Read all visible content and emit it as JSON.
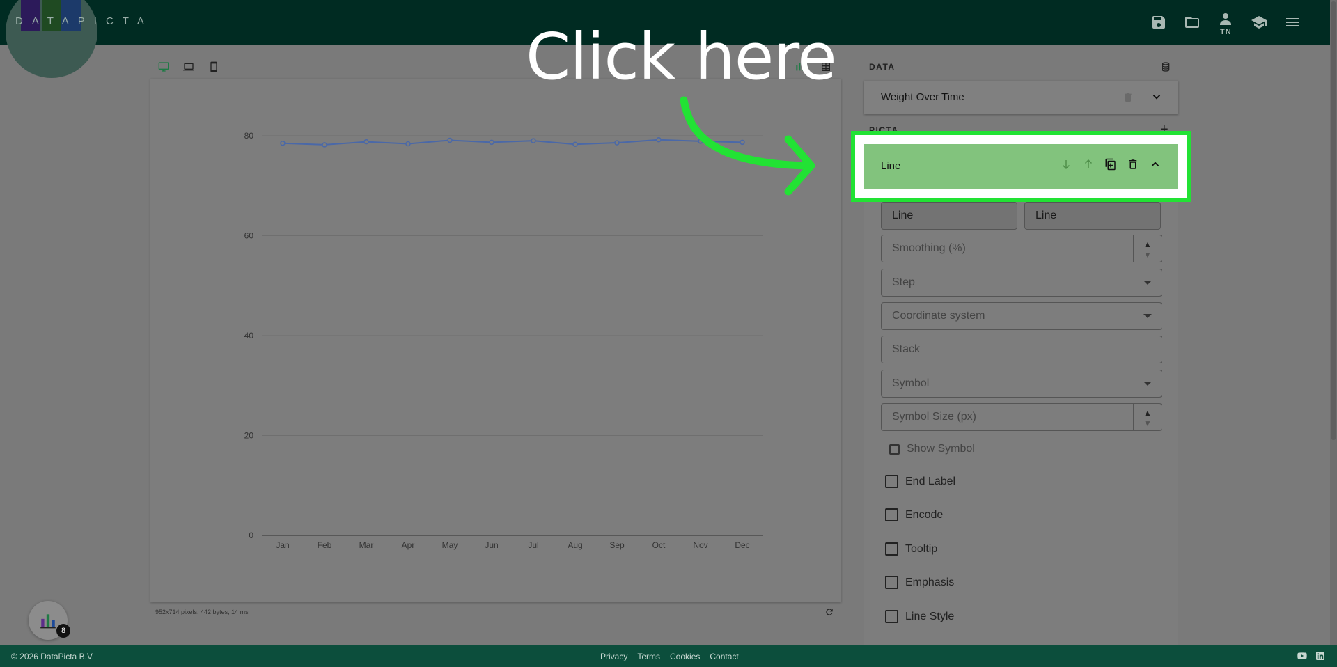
{
  "app": {
    "logo_text": "DATAPICTA",
    "user_initials": "TN"
  },
  "annotation": {
    "text": "Click here"
  },
  "chart_data": {
    "type": "line",
    "categories": [
      "Jan",
      "Feb",
      "Mar",
      "Apr",
      "May",
      "Jun",
      "Jul",
      "Aug",
      "Sep",
      "Oct",
      "Nov",
      "Dec"
    ],
    "series": [
      {
        "values": [
          78.5,
          78.2,
          78.8,
          78.4,
          79.1,
          78.7,
          79.0,
          78.3,
          78.6,
          79.2,
          78.9,
          78.7
        ]
      }
    ],
    "ylim": [
      0,
      80
    ],
    "yticks": [
      "0",
      "20",
      "40",
      "60",
      "80"
    ],
    "grid": true,
    "line_color": "#4a68a8"
  },
  "chart_meta": "952x714 pixels, 442 bytes, 14 ms",
  "panel": {
    "data_title": "DATA",
    "data_set_name": "Weight Over Time",
    "picta_title": "PICTA",
    "layer_name": "Line",
    "field_left": "Line",
    "field_right": "Line",
    "smoothing": "Smoothing (%)",
    "step": "Step",
    "coordinate_system": "Coordinate system",
    "stack": "Stack",
    "symbol": "Symbol",
    "symbol_size": "Symbol Size (px)",
    "show_symbol": "Show Symbol",
    "checkboxes": [
      "End Label",
      "Encode",
      "Tooltip",
      "Emphasis",
      "Line Style"
    ]
  },
  "footer": {
    "copyright": "© 2026 DataPicta B.V.",
    "links": [
      "Privacy",
      "Terms",
      "Cookies",
      "Contact"
    ]
  },
  "fab_badge": "8",
  "colors": {
    "topbar": "#002b22",
    "footer": "#0c4e3c",
    "highlight_border": "#22e234",
    "highlight_fill": "#82c37d"
  }
}
